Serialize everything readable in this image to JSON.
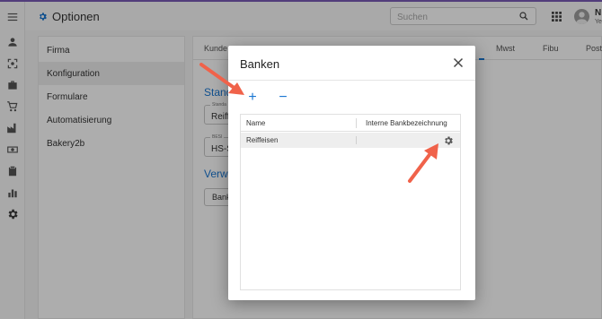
{
  "colors": {
    "accent": "#1976d2",
    "annotation_arrow": "#f0624a",
    "overlay": "rgba(0,0,0,0.32)"
  },
  "rail": {
    "icons": [
      "menu-icon",
      "person-icon",
      "scan-icon",
      "briefcase-icon",
      "cart-icon",
      "factory-icon",
      "money-icon",
      "clipboard-icon",
      "bar-chart-icon",
      "settings-icon"
    ],
    "active": "settings-icon"
  },
  "header": {
    "title": "Optionen",
    "search_placeholder": "Suchen",
    "user_initial": "N",
    "user_sub": "Ye"
  },
  "nav": {
    "items": [
      {
        "label": "Firma"
      },
      {
        "label": "Konfiguration",
        "selected": true
      },
      {
        "label": "Formulare"
      },
      {
        "label": "Automatisierung"
      },
      {
        "label": "Bakery2b"
      }
    ]
  },
  "main": {
    "tabs": [
      "Kunde",
      "Mwst",
      "Fibu",
      "Post"
    ],
    "active_tab": "Mwst",
    "section1": "Stand",
    "field1_label": "Standa",
    "field1_value": "Reiffe",
    "field2_label": "BESI",
    "field2_value": "HS-S",
    "section2": "Verw",
    "button_partial": "Bank"
  },
  "dialog": {
    "title": "Banken",
    "add": "+",
    "remove": "−",
    "grid": {
      "columns": [
        "Name",
        "Interne Bankbezeichnung"
      ],
      "rows": [
        {
          "name": "Reiffeisen",
          "internal": ""
        }
      ]
    }
  }
}
